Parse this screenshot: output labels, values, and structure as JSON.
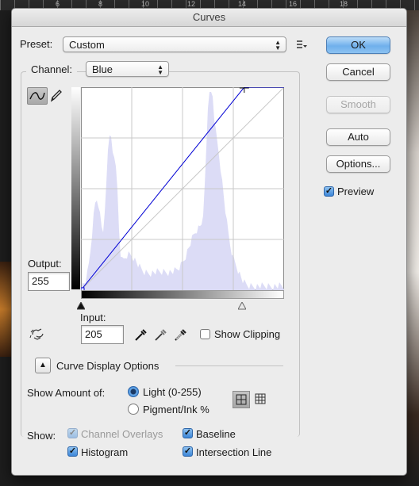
{
  "ruler": {
    "marks": [
      "6",
      "8",
      "10",
      "12",
      "14",
      "16",
      "18"
    ]
  },
  "dialog": {
    "title": "Curves"
  },
  "preset": {
    "label": "Preset:",
    "value": "Custom"
  },
  "channel": {
    "label": "Channel:",
    "value": "Blue"
  },
  "buttons": {
    "ok": "OK",
    "cancel": "Cancel",
    "smooth": "Smooth",
    "auto": "Auto",
    "options": "Options..."
  },
  "preview": {
    "label": "Preview",
    "checked": true
  },
  "output": {
    "label": "Output:",
    "value": "255"
  },
  "input": {
    "label": "Input:",
    "value": "205"
  },
  "show_clipping": {
    "label": "Show Clipping",
    "checked": false
  },
  "curve_display": {
    "label": "Curve Display Options"
  },
  "show_amount": {
    "label": "Show Amount of:",
    "light_label": "Light  (0-255)",
    "pigment_label": "Pigment/Ink %",
    "selected": "light"
  },
  "show": {
    "label": "Show:",
    "channel_overlays": {
      "label": "Channel Overlays",
      "checked": true,
      "disabled": true
    },
    "baseline": {
      "label": "Baseline",
      "checked": true
    },
    "histogram": {
      "label": "Histogram",
      "checked": true
    },
    "intersection_line": {
      "label": "Intersection Line",
      "checked": true
    }
  },
  "curve": {
    "points": [
      [
        0,
        0
      ],
      [
        205,
        255
      ],
      [
        255,
        255
      ]
    ],
    "channel_color": "#0000d4"
  },
  "colors": {
    "histogram": "#dcdcf6",
    "ok_button": "#6fb0ec",
    "curve": "#0000d4"
  }
}
